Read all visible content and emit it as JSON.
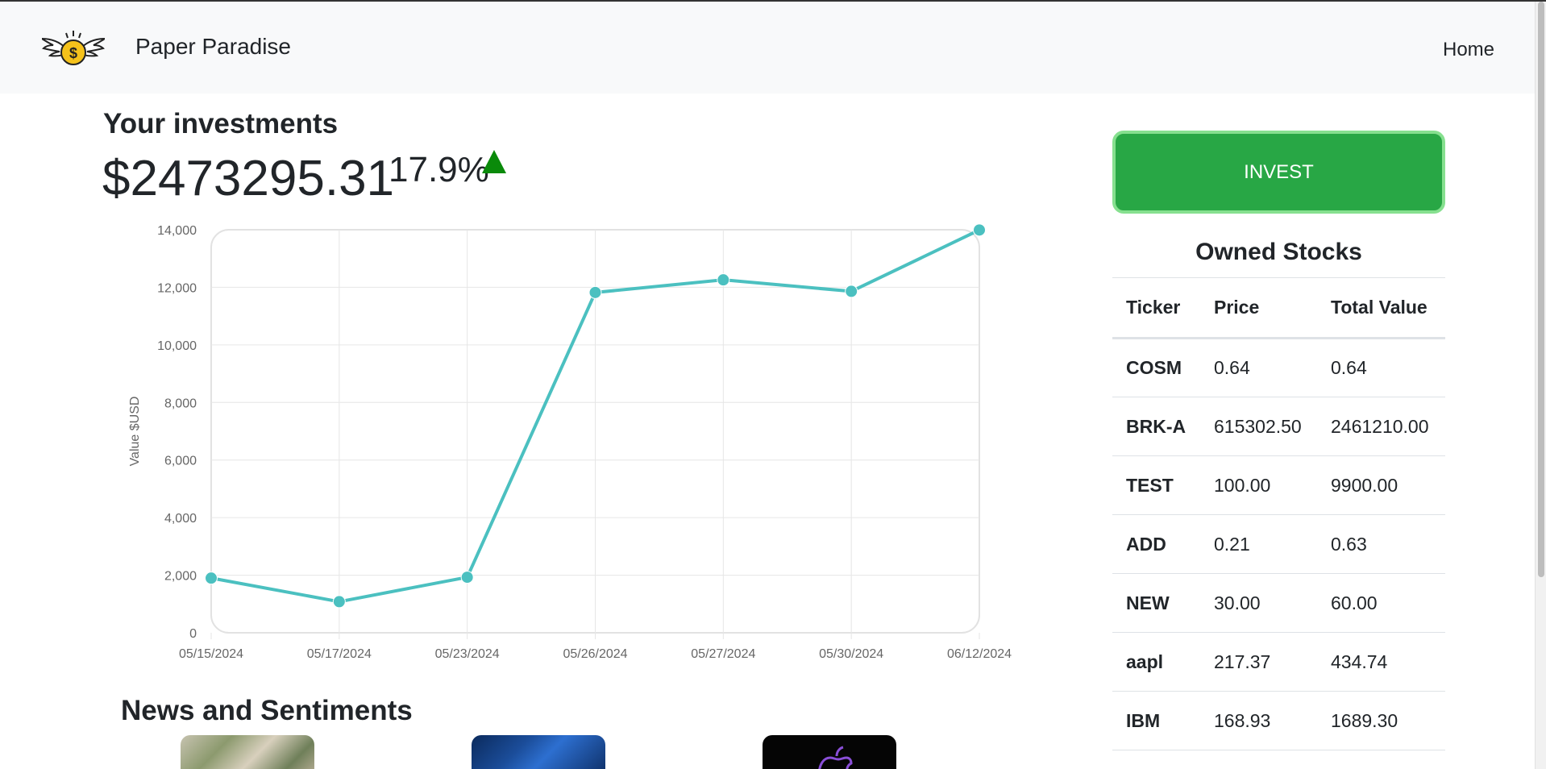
{
  "navbar": {
    "brand": "Paper Paradise",
    "home_link": "Home",
    "logo_icon": "winged-dollar-coin-icon"
  },
  "summary": {
    "title": "Your investments",
    "total_value": "$2473295.31",
    "change_percent": "17.9%",
    "trend_icon": "up-triangle-icon",
    "trend_color": "#0a8a0a"
  },
  "chart_data": {
    "type": "line",
    "ylabel": "Value $USD",
    "xlabel": "",
    "categories": [
      "05/15/2024",
      "05/17/2024",
      "05/23/2024",
      "05/26/2024",
      "05/27/2024",
      "05/30/2024",
      "06/12/2024"
    ],
    "series": [
      {
        "values": [
          1900,
          1080,
          1930,
          11820,
          12260,
          11860,
          13990
        ],
        "color": "#4bc0c0"
      }
    ],
    "ylim": [
      0,
      14000
    ],
    "y_ticks": [
      "0",
      "2,000",
      "4,000",
      "6,000",
      "8,000",
      "10,000",
      "12,000",
      "14,000"
    ],
    "grid": true
  },
  "invest_button": {
    "label": "INVEST",
    "color": "#28a745"
  },
  "owned_stocks": {
    "title": "Owned Stocks",
    "headers": [
      "Ticker",
      "Price",
      "Total Value"
    ],
    "rows": [
      [
        "COSM",
        "0.64",
        "0.64"
      ],
      [
        "BRK-A",
        "615302.50",
        "2461210.00"
      ],
      [
        "TEST",
        "100.00",
        "9900.00"
      ],
      [
        "ADD",
        "0.21",
        "0.63"
      ],
      [
        "NEW",
        "30.00",
        "60.00"
      ],
      [
        "aapl",
        "217.37",
        "434.74"
      ],
      [
        "IBM",
        "168.93",
        "1689.30"
      ]
    ]
  },
  "news": {
    "title": "News and Sentiments",
    "thumbnails": [
      "news-thumbnail-plants",
      "news-thumbnail-trading-floor",
      "news-thumbnail-apple-logo"
    ]
  }
}
